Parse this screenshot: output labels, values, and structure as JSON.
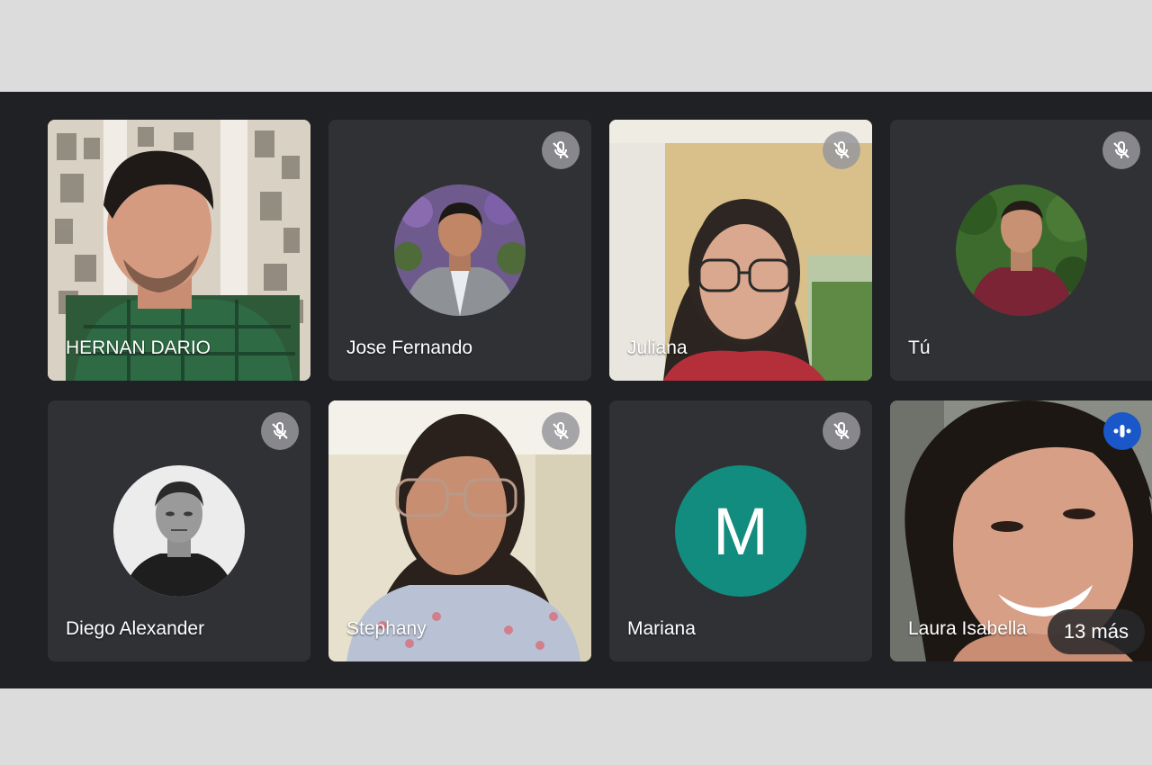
{
  "participants": [
    {
      "name": "HERNAN DARIO",
      "type": "video",
      "muted": false
    },
    {
      "name": "Jose Fernando",
      "type": "avatar",
      "muted": true
    },
    {
      "name": "Juliana",
      "type": "video",
      "muted": true
    },
    {
      "name": "Tú",
      "type": "avatar",
      "muted": true
    },
    {
      "name": "Diego Alexander",
      "type": "avatar",
      "muted": true
    },
    {
      "name": "Stephany",
      "type": "video",
      "muted": true
    },
    {
      "name": "Mariana",
      "type": "letter",
      "initial": "M",
      "muted": true
    },
    {
      "name": "Laura Isabella",
      "type": "video",
      "muted": false,
      "speaking": true
    }
  ],
  "overflow": {
    "label": "13 más"
  },
  "icons": {
    "muted": "mic-off-icon",
    "speaking": "audio-level-icon"
  },
  "colors": {
    "stage_background": "#202124",
    "tile_background": "#3c4043",
    "letter_avatar": "#128c7e",
    "speaking_indicator": "#1a57c8"
  }
}
